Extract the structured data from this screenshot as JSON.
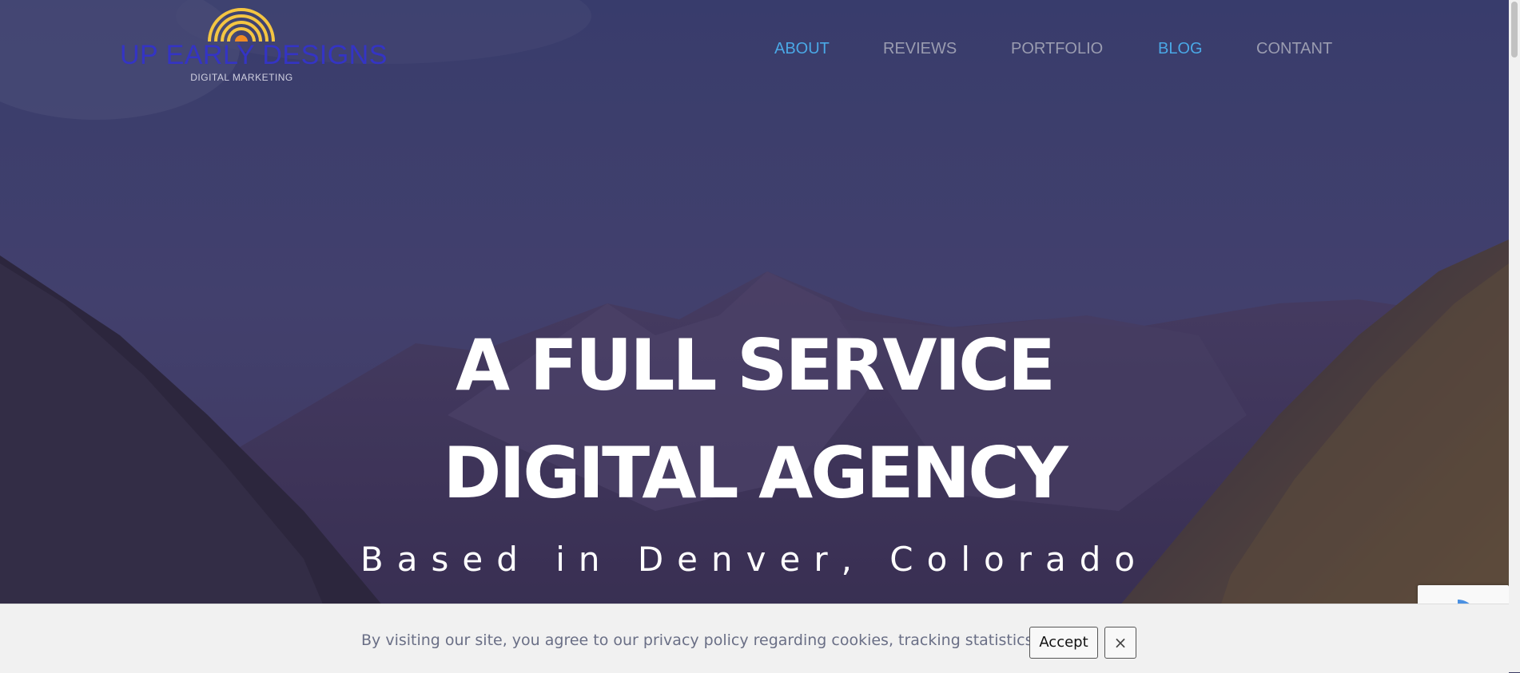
{
  "header": {
    "logo": {
      "title": "UP EARLY DESIGNS",
      "subtitle": "DIGITAL MARKETING"
    },
    "nav": [
      {
        "label": "ABOUT",
        "color": "#4aa8e6"
      },
      {
        "label": "REVIEWS",
        "color": "#9a9cb0"
      },
      {
        "label": "PORTFOLIO",
        "color": "#9a9cb0"
      },
      {
        "label": "BLOG",
        "color": "#4aa8e6"
      },
      {
        "label": "CONTANT",
        "color": "#9a9cb0"
      }
    ]
  },
  "hero": {
    "line1": "A FULL SERVICE",
    "line2": "DIGITAL AGENCY",
    "tagline": "Based in Denver, Colorado"
  },
  "cookie_banner": {
    "text": "By visiting our site, you agree to our privacy policy regarding cookies, tracking statistics, etc.",
    "accept_label": "Accept",
    "close_label": "×"
  },
  "colors": {
    "logo_title": "#3434c4",
    "logo_arc": "#f4c542",
    "logo_sun": "#f08a24",
    "nav_active": "#4aa8e6",
    "nav_inactive": "#9a9cb0"
  }
}
